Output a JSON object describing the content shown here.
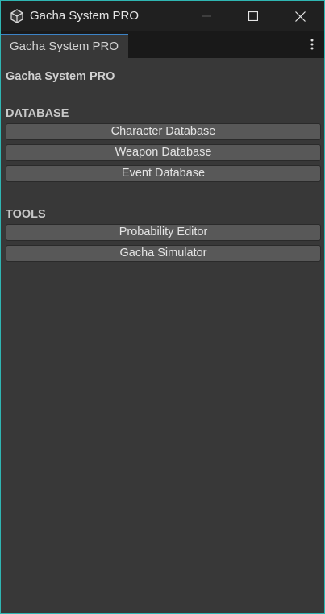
{
  "window": {
    "title": "Gacha System PRO",
    "accent_border_color": "#2fb6b3",
    "controls": [
      "minimize-icon",
      "maximize-icon",
      "close-icon"
    ],
    "app_icon": "unity-cube-icon"
  },
  "tabbar": {
    "active_tab": "Gacha System PRO",
    "tab_highlight_color": "#3c83c6",
    "menu_icon": "kebab-menu-icon"
  },
  "panel": {
    "heading": "Gacha System PRO",
    "sections": {
      "database": {
        "label": "DATABASE",
        "buttons": [
          "Character Database",
          "Weapon Database",
          "Event Database"
        ]
      },
      "tools": {
        "label": "TOOLS",
        "buttons": [
          "Probability Editor",
          "Gacha Simulator"
        ]
      }
    }
  }
}
